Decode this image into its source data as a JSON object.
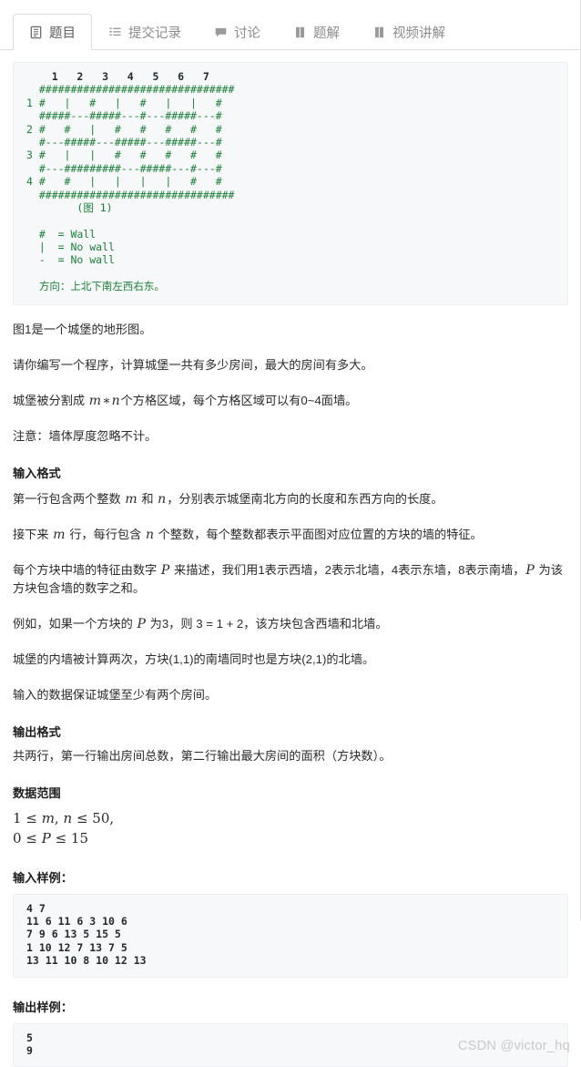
{
  "tabs": [
    {
      "label": "题目",
      "icon": "document-icon",
      "active": true
    },
    {
      "label": "提交记录",
      "icon": "list-icon",
      "active": false
    },
    {
      "label": "讨论",
      "icon": "chat-icon",
      "active": false
    },
    {
      "label": "题解",
      "icon": "book-icon",
      "active": false
    },
    {
      "label": "视频讲解",
      "icon": "book-icon",
      "active": false
    }
  ],
  "figure": {
    "header_row": "    1   2   3   4   5   6   7",
    "lines": [
      "  ###############################",
      "1 #   |   #   |   #   |   |   #",
      "  #####---#####---#---#####---#",
      "2 #   #   |   #   #   #   #   #",
      "  #---#####---#####---#####---#",
      "3 #   |   |   #   #   #   #   #",
      "  #---#########---#####---#---#",
      "4 #   #   |   |   |   |   #   #",
      "  ###############################"
    ],
    "caption": "(图 1)",
    "legend": [
      "#  = Wall",
      "|  = No wall",
      "-  = No wall"
    ],
    "direction_note": "方向：上北下南左西右东。"
  },
  "body": {
    "p1": "图1是一个城堡的地形图。",
    "p2": "请你编写一个程序，计算城堡一共有多少房间，最大的房间有多大。",
    "p3_a": "城堡被分割成",
    "p3_m": "m",
    "p3_star": "∗",
    "p3_n": "n",
    "p3_b": "个方格区域，每个方格区域可以有0~4面墙。",
    "p4": "注意：墙体厚度忽略不计。"
  },
  "input_format": {
    "heading": "输入格式",
    "p1_a": "第一行包含两个整数",
    "p1_m": "m",
    "p1_mid": "和",
    "p1_n": "n",
    "p1_b": "，分别表示城堡南北方向的长度和东西方向的长度。",
    "p2_a": "接下来",
    "p2_m": "m",
    "p2_mid": "行，每行包含",
    "p2_n": "n",
    "p2_b": "个整数，每个整数都表示平面图对应位置的方块的墙的特征。",
    "p3_a": "每个方块中墙的特征由数字",
    "p3_P": "P",
    "p3_mid": "来描述，我们用1表示西墙，2表示北墙，4表示东墙，8表示南墙，",
    "p3_P2": "P",
    "p3_b": "为该方块包含墙的数字之和。",
    "p4_a": "例如，如果一个方块的",
    "p4_P": "P",
    "p4_b": "为3，则 3 = 1 + 2，该方块包含西墙和北墙。",
    "p5": "城堡的内墙被计算两次，方块(1,1)的南墙同时也是方块(2,1)的北墙。",
    "p6": "输入的数据保证城堡至少有两个房间。"
  },
  "output_format": {
    "heading": "输出格式",
    "p1": "共两行，第一行输出房间总数，第二行输出最大房间的面积（方块数）。"
  },
  "data_range": {
    "heading": "数据范围",
    "line1": "1 ≤ m, n ≤ 50,",
    "line1_parts": {
      "lo": "1",
      "rel1": "≤",
      "v1": "m",
      "comma": ",",
      "v2": "n",
      "rel2": "≤",
      "hi": "50,"
    },
    "line2_parts": {
      "lo": "0",
      "rel1": "≤",
      "v1": "P",
      "rel2": "≤",
      "hi": "15"
    }
  },
  "input_sample": {
    "label": "输入样例：",
    "text": "4 7\n11 6 11 6 3 10 6\n7 9 6 13 5 15 5\n1 10 12 7 13 7 5\n13 11 10 8 10 12 13"
  },
  "output_sample": {
    "label": "输出样例：",
    "text": "5\n9"
  },
  "watermark": "CSDN @victor_hq",
  "colors": {
    "figure_green": "#1a7f37",
    "code_bg": "#f7f8fa",
    "tab_inactive": "#8c8c8c",
    "watermark": "#c9c9c9"
  }
}
